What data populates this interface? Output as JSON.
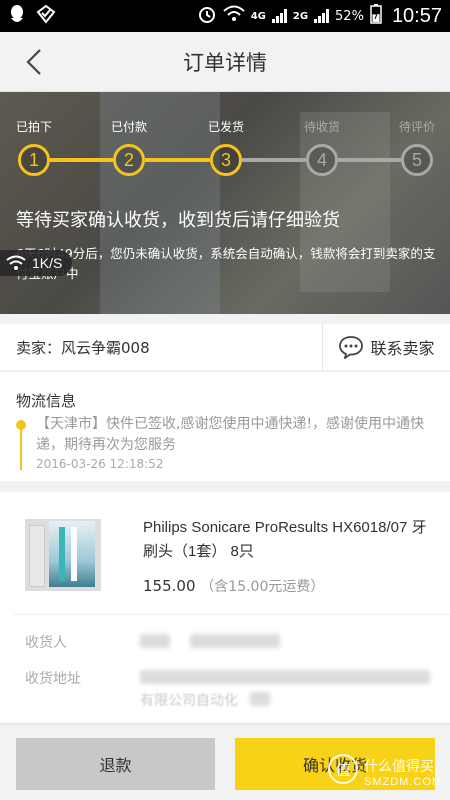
{
  "status_bar": {
    "time": "10:57",
    "battery": "52%",
    "network_a": "4G",
    "network_b": "2G",
    "icons": [
      "qq-icon",
      "message-icon",
      "alarm-icon",
      "wifi-icon",
      "signal-icon",
      "battery-icon"
    ]
  },
  "header": {
    "title": "订单详情"
  },
  "progress": {
    "steps": [
      {
        "num": "1",
        "label": "已拍下",
        "done": true
      },
      {
        "num": "2",
        "label": "已付款",
        "done": true
      },
      {
        "num": "3",
        "label": "已发货",
        "done": true
      },
      {
        "num": "4",
        "label": "待收货",
        "done": false
      },
      {
        "num": "5",
        "label": "待评价",
        "done": false
      }
    ],
    "active_color": "#f5c31e",
    "inactive_color": "#a8a8a8"
  },
  "hero": {
    "title": "等待买家确认收货，收到货后请仔细验货",
    "desc": "6天6时49分后，您仍未确认收货，系统会自动确认，钱款将会打到卖家的支付宝账户中",
    "speed": "1K/S"
  },
  "seller": {
    "name": "卖家：风云争霸008",
    "contact_label": "联系卖家"
  },
  "logistics": {
    "title": "物流信息",
    "message": "【天津市】快件已签收,感谢您使用中通快递!，感谢使用中通快递，期待再次为您服务",
    "time": "2016-03-26 12:18:52"
  },
  "product": {
    "name": "Philips Sonicare ProResults HX6018/07 牙刷头（1套） 8只",
    "price": "155.00",
    "shipping_note": "（含15.00元运费）"
  },
  "recipient": {
    "name_label": "收货人",
    "address_label": "收货地址",
    "address_partial": "有限公司自动化"
  },
  "actions": {
    "refund_label": "退款",
    "confirm_label": "确认收货"
  },
  "watermark": {
    "text": "什么值得买",
    "sub": "SMZDM.COM"
  },
  "colors": {
    "accent": "#f8d217",
    "refund_bg": "#c8c8c8"
  }
}
